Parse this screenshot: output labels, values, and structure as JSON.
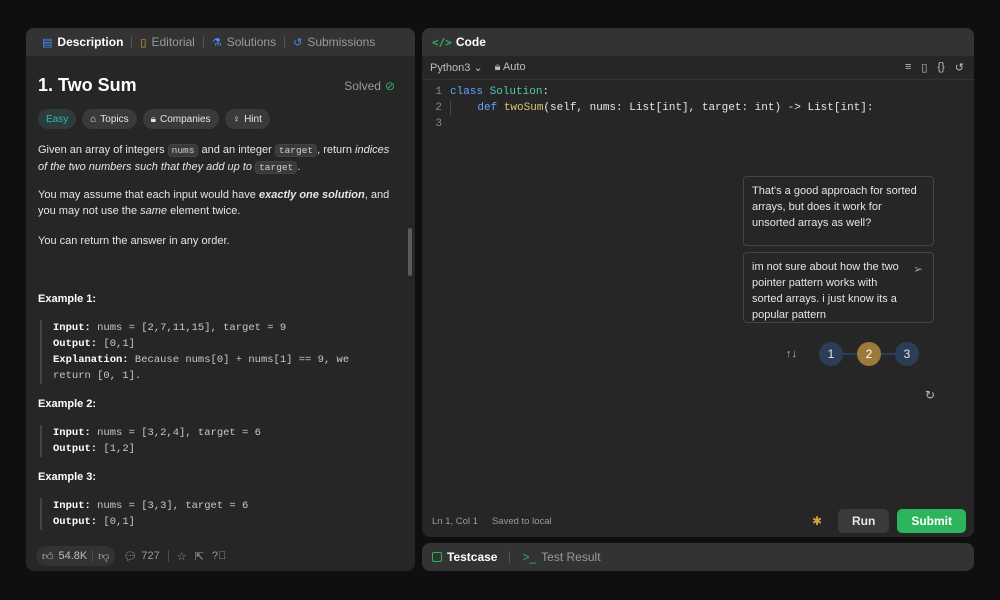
{
  "left_tabs": [
    "Description",
    "Editorial",
    "Solutions",
    "Submissions"
  ],
  "problem": {
    "title": "1. Two Sum",
    "status": "Solved",
    "tags": [
      "Easy",
      "Topics",
      "Companies",
      "Hint"
    ],
    "p1_a": "Given an array of integers ",
    "p1_code1": "nums",
    "p1_b": " and an integer ",
    "p1_code2": "target",
    "p1_c": ", return ",
    "p1_em": "indices of the two numbers such that they add up to",
    "p1_code3": "target",
    "p1_d": ".",
    "p2_a": "You may assume that each input would have ",
    "p2_strong": "exactly one solution",
    "p2_b": ", and you may not use the ",
    "p2_em": "same",
    "p2_c": " element twice.",
    "p3": "You can return the answer in any order."
  },
  "examples": [
    {
      "title": "Example 1:",
      "input_label": "Input:",
      "input": " nums = [2,7,11,15], target = 9",
      "output_label": "Output:",
      "output": " [0,1]",
      "expl_label": "Explanation:",
      "expl1": " Because nums[0] + nums[1] == 9, we",
      "expl2": "return [0, 1]."
    },
    {
      "title": "Example 2:",
      "input_label": "Input:",
      "input": " nums = [3,2,4], target = 6",
      "output_label": "Output:",
      "output": " [1,2]"
    },
    {
      "title": "Example 3:",
      "input_label": "Input:",
      "input": " nums = [3,3], target = 6",
      "output_label": "Output:",
      "output": " [0,1]"
    }
  ],
  "footer": {
    "likes": "54.8K",
    "comments": "727"
  },
  "code": {
    "header": "Code",
    "language": "Python3",
    "mode": "Auto",
    "lines": [
      {
        "n": "1",
        "kw": "class ",
        "cls": "Solution",
        "rest": ":"
      },
      {
        "n": "2",
        "kw": "def ",
        "fn": "twoSum",
        "a": "(self, nums: List[int], target: int) -> List[int]:"
      },
      {
        "n": "3"
      }
    ],
    "status_pos": "Ln 1, Col 1",
    "status_saved": "Saved to local",
    "run_label": "Run",
    "submit_label": "Submit"
  },
  "chat": {
    "ai_message": "That's a good approach for sorted arrays, but does it work for unsorted arrays as well?",
    "user_message": "im not sure about how the two pointer pattern works with sorted arrays. i just know its a popular pattern",
    "pages": [
      "1",
      "2",
      "3"
    ],
    "active_page": "2"
  },
  "bottom_tabs": [
    "Testcase",
    "Test Result"
  ],
  "colors": {
    "accent_green": "#2db55d",
    "active_page": "#9c7a3a",
    "page_bg": "#2c3e57"
  }
}
